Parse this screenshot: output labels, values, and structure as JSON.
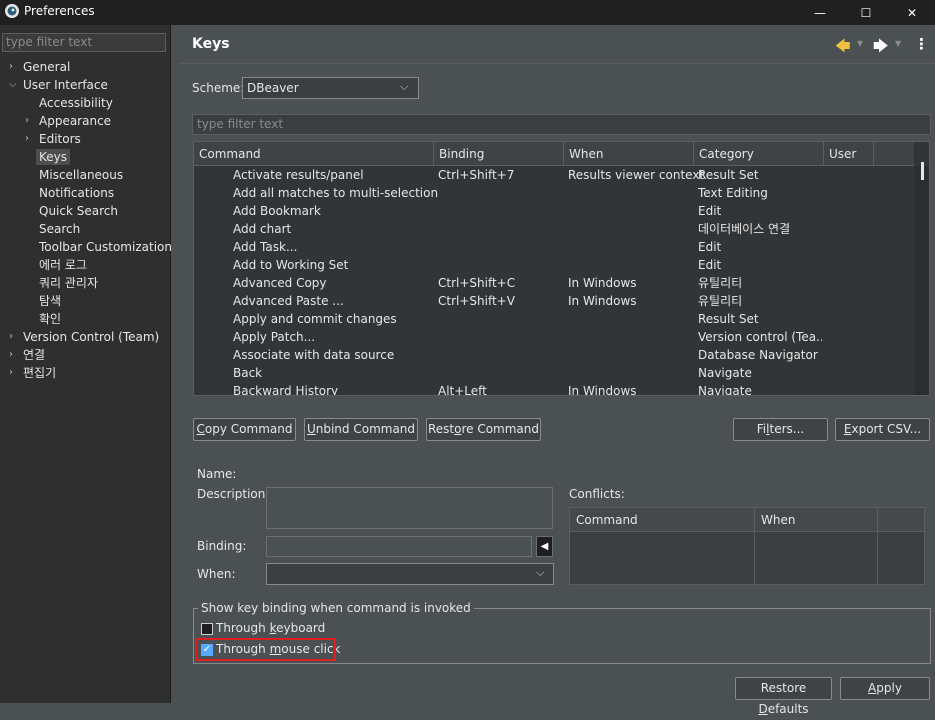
{
  "window": {
    "title": "Preferences",
    "min_glyph": "—",
    "max_glyph": "☐",
    "close_glyph": "✕"
  },
  "sidebar": {
    "filter_placeholder": "type filter text",
    "items": [
      {
        "label": "General",
        "expandable": true,
        "level": 0
      },
      {
        "label": "User Interface",
        "expanded": true,
        "level": 0
      },
      {
        "label": "Accessibility",
        "level": 1
      },
      {
        "label": "Appearance",
        "expandable": true,
        "level": 1
      },
      {
        "label": "Editors",
        "expandable": true,
        "level": 1
      },
      {
        "label": "Keys",
        "selected": true,
        "level": 1
      },
      {
        "label": "Miscellaneous",
        "level": 1
      },
      {
        "label": "Notifications",
        "level": 1
      },
      {
        "label": "Quick Search",
        "level": 1
      },
      {
        "label": "Search",
        "level": 1
      },
      {
        "label": "Toolbar Customization",
        "level": 1
      },
      {
        "label": "에러 로그",
        "level": 1
      },
      {
        "label": "쿼리 관리자",
        "level": 1
      },
      {
        "label": "탐색",
        "level": 1
      },
      {
        "label": "확인",
        "level": 1
      },
      {
        "label": "Version Control (Team)",
        "expandable": true,
        "level": 0
      },
      {
        "label": "연결",
        "expandable": true,
        "level": 0
      },
      {
        "label": "편집기",
        "expandable": true,
        "level": 0
      }
    ]
  },
  "page": {
    "title": "Keys",
    "scheme_label": "Scheme:",
    "scheme_value": "DBeaver",
    "filter_placeholder": "type filter text"
  },
  "table": {
    "columns": [
      "Command",
      "Binding",
      "When",
      "Category",
      "User"
    ],
    "rows": [
      {
        "command": "Activate results/panel",
        "binding": "Ctrl+Shift+7",
        "when": "Results viewer context",
        "category": "Result Set"
      },
      {
        "command": "Add all matches to multi-selection",
        "binding": "",
        "when": "",
        "category": "Text Editing"
      },
      {
        "command": "Add Bookmark",
        "binding": "",
        "when": "",
        "category": "Edit"
      },
      {
        "command": "Add chart",
        "binding": "",
        "when": "",
        "category": "데이터베이스 연결"
      },
      {
        "command": "Add Task...",
        "binding": "",
        "when": "",
        "category": "Edit"
      },
      {
        "command": "Add to Working Set",
        "binding": "",
        "when": "",
        "category": "Edit"
      },
      {
        "command": "Advanced Copy",
        "binding": "Ctrl+Shift+C",
        "when": "In Windows",
        "category": "유틸리티"
      },
      {
        "command": "Advanced Paste ...",
        "binding": "Ctrl+Shift+V",
        "when": "In Windows",
        "category": "유틸리티"
      },
      {
        "command": "Apply and commit changes",
        "binding": "",
        "when": "",
        "category": "Result Set"
      },
      {
        "command": "Apply Patch...",
        "binding": "",
        "when": "",
        "category": "Version control (Tea..."
      },
      {
        "command": "Associate with data source",
        "binding": "",
        "when": "",
        "category": "Database Navigator"
      },
      {
        "command": "Back",
        "binding": "",
        "when": "",
        "category": "Navigate"
      },
      {
        "command": "Backward History",
        "binding": "Alt+Left",
        "when": "In Windows",
        "category": "Navigate"
      }
    ]
  },
  "buttons": {
    "copy_command": {
      "mn": "C",
      "rest": "opy Command"
    },
    "unbind_command": {
      "mn": "U",
      "rest": "nbind Command"
    },
    "restore_command": {
      "pre": "Rest",
      "mn": "o",
      "rest": "re Command"
    },
    "filters": {
      "pre": "Fi",
      "mn": "l",
      "rest": "ters..."
    },
    "export_csv": {
      "mn": "E",
      "rest": "xport CSV..."
    },
    "restore_defaults": {
      "pre": "Restore ",
      "mn": "D",
      "rest": "efaults"
    },
    "apply": {
      "mn": "A",
      "rest": "pply"
    }
  },
  "details": {
    "name_label": "Name:",
    "description_label": "Description:",
    "binding_label": "Binding:",
    "when_label": "When:",
    "conflicts_label": "Conflicts:",
    "conflicts_columns": [
      "Command",
      "When"
    ]
  },
  "group": {
    "title": "Show key binding when command is invoked",
    "keyboard": {
      "pre": "Through ",
      "mn": "k",
      "rest": "eyboard",
      "checked": false
    },
    "mouse": {
      "pre": "Through ",
      "mn": "m",
      "rest": "ouse click",
      "checked": true
    }
  },
  "colors": {
    "highlight_border": "#e02020",
    "checkbox_checked": "#55aaff"
  }
}
